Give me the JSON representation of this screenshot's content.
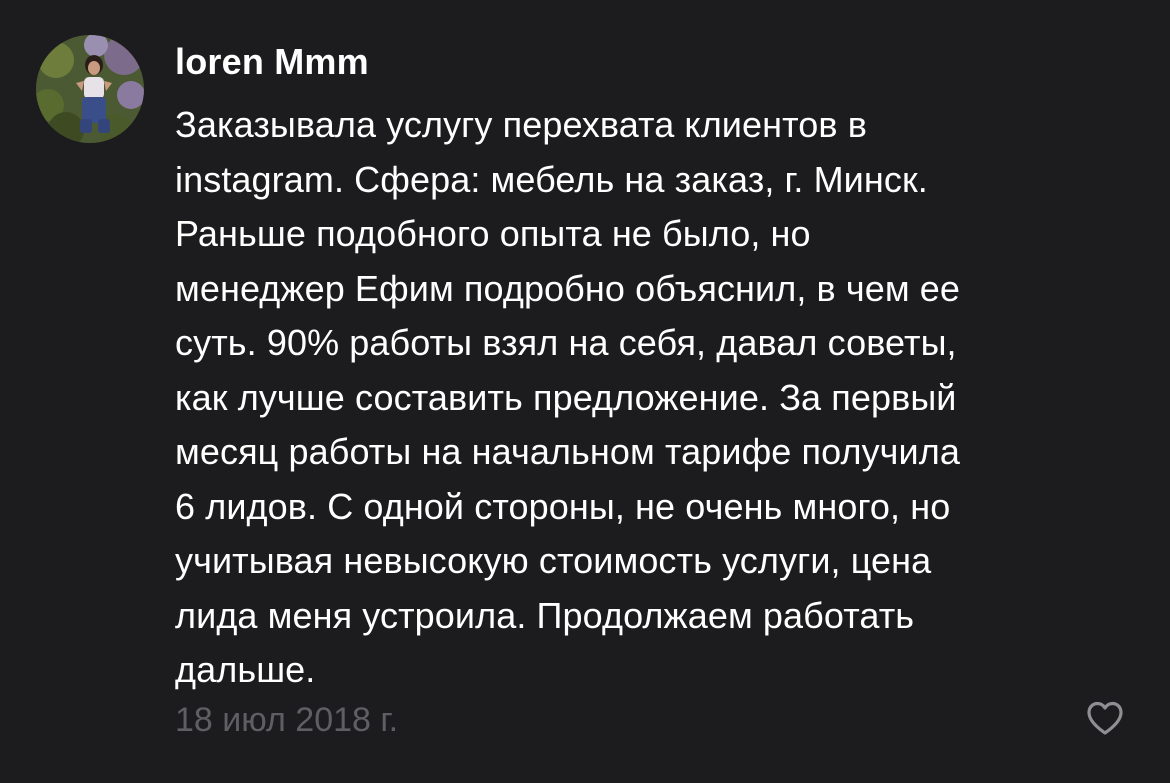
{
  "comment": {
    "username": "loren Mmm",
    "avatar_icon": "user-avatar-photo",
    "body_lines": [
      "Заказывала услугу перехвата клиентов в",
      "instagram. Сфера: мебель на заказ, г. Минск.",
      "Раньше подобного опыта не было, но",
      "менеджер Ефим подробно объяснил, в чем ее",
      "суть. 90% работы взял на себя, давал советы,",
      "как лучше составить предложение. За первый",
      "месяц работы на начальном тарифе получила",
      "6 лидов. С одной стороны, не очень много, но",
      "учитывая невысокую стоимость услуги, цена",
      "лида меня устроила. Продолжаем работать",
      "дальше."
    ],
    "date": "18 июл 2018 г.",
    "like_icon": "heart-outline-icon"
  },
  "colors": {
    "background": "#1c1c1e",
    "text": "#ffffff",
    "muted": "#5f5f63"
  }
}
